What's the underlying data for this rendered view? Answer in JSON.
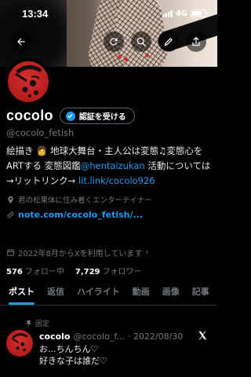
{
  "status_bar": {
    "time": "13:34",
    "network": "4G"
  },
  "profile": {
    "name": "cocolo",
    "verify_button": "認証を受ける",
    "handle": "@cocolo_fetish",
    "bio": {
      "line1": "絵描き 👩 地球大舞台・主人公は変態♫変態心を",
      "line2_a": "ARTする 変態図鑑",
      "line2_link": "@hentaizukan",
      "line2_b": " 活動については",
      "line3_a": "→リットリンク→ ",
      "line3_link": "lit.link/cocolo926"
    },
    "professional_category": "君の松果体に住み着くエンターテイナー",
    "website": "note.com/cocolo_fetish/...",
    "joined": "2022年8月からXを利用しています",
    "following_count": "576",
    "following_label": "フォロー中",
    "followers_count": "7,729",
    "followers_label": "フォロワー"
  },
  "tabs": [
    "ポスト",
    "返信",
    "ハイライト",
    "動画",
    "画像",
    "記事"
  ],
  "pinned_post": {
    "pinned_label": "固定",
    "name": "cocolo",
    "handle": "@cocolo_f...",
    "date": "· 2022/08/30",
    "line1": "お...ちんちん♡",
    "line2": "好きな子は誰だ♡"
  },
  "icons": {
    "back": "back-arrow-icon",
    "refresh": "refresh-icon",
    "search": "search-icon",
    "edit": "pencil-icon",
    "share": "share-icon",
    "verified": "verified-check-icon",
    "location": "location-pin-icon",
    "link": "link-icon",
    "calendar": "calendar-icon",
    "pin": "pin-icon",
    "platform": "x-logo-icon"
  },
  "colors": {
    "accent": "#1d9bf0",
    "background": "#000000",
    "muted": "#71767b"
  }
}
